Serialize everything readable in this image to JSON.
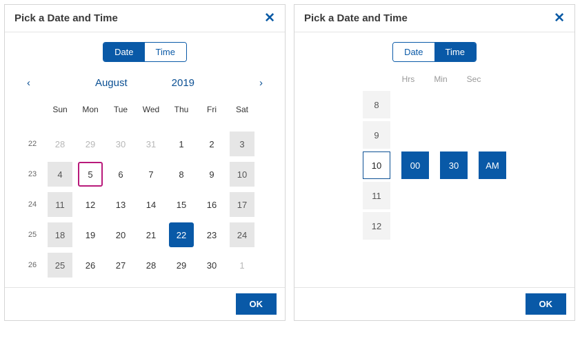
{
  "common": {
    "title": "Pick a Date and Time",
    "seg_date": "Date",
    "seg_time": "Time",
    "ok": "OK",
    "close": "✕"
  },
  "date_panel": {
    "month": "August",
    "year": "2019",
    "dow": [
      "Sun",
      "Mon",
      "Tue",
      "Wed",
      "Thu",
      "Fri",
      "Sat"
    ],
    "weeks": [
      {
        "num": "22",
        "days": [
          {
            "n": "28",
            "other": true
          },
          {
            "n": "29",
            "other": true
          },
          {
            "n": "30",
            "other": true
          },
          {
            "n": "31",
            "other": true
          },
          {
            "n": "1"
          },
          {
            "n": "2"
          },
          {
            "n": "3",
            "weekend": true
          }
        ]
      },
      {
        "num": "23",
        "days": [
          {
            "n": "4",
            "weekend": true
          },
          {
            "n": "5",
            "today": true
          },
          {
            "n": "6"
          },
          {
            "n": "7"
          },
          {
            "n": "8"
          },
          {
            "n": "9"
          },
          {
            "n": "10",
            "weekend": true
          }
        ]
      },
      {
        "num": "24",
        "days": [
          {
            "n": "11",
            "weekend": true
          },
          {
            "n": "12"
          },
          {
            "n": "13"
          },
          {
            "n": "14"
          },
          {
            "n": "15"
          },
          {
            "n": "16"
          },
          {
            "n": "17",
            "weekend": true
          }
        ]
      },
      {
        "num": "25",
        "days": [
          {
            "n": "18",
            "weekend": true
          },
          {
            "n": "19"
          },
          {
            "n": "20"
          },
          {
            "n": "21"
          },
          {
            "n": "22",
            "selected": true
          },
          {
            "n": "23"
          },
          {
            "n": "24",
            "weekend": true
          }
        ]
      },
      {
        "num": "26",
        "days": [
          {
            "n": "25",
            "weekend": true
          },
          {
            "n": "26"
          },
          {
            "n": "27"
          },
          {
            "n": "28"
          },
          {
            "n": "29"
          },
          {
            "n": "30"
          },
          {
            "n": "1",
            "other": true
          }
        ]
      }
    ]
  },
  "time_panel": {
    "labels": {
      "hrs": "Hrs",
      "min": "Min",
      "sec": "Sec"
    },
    "hours": [
      "8",
      "9",
      "10",
      "11",
      "12"
    ],
    "hour_selected": "10",
    "minute": "00",
    "second": "30",
    "ampm": "AM"
  }
}
